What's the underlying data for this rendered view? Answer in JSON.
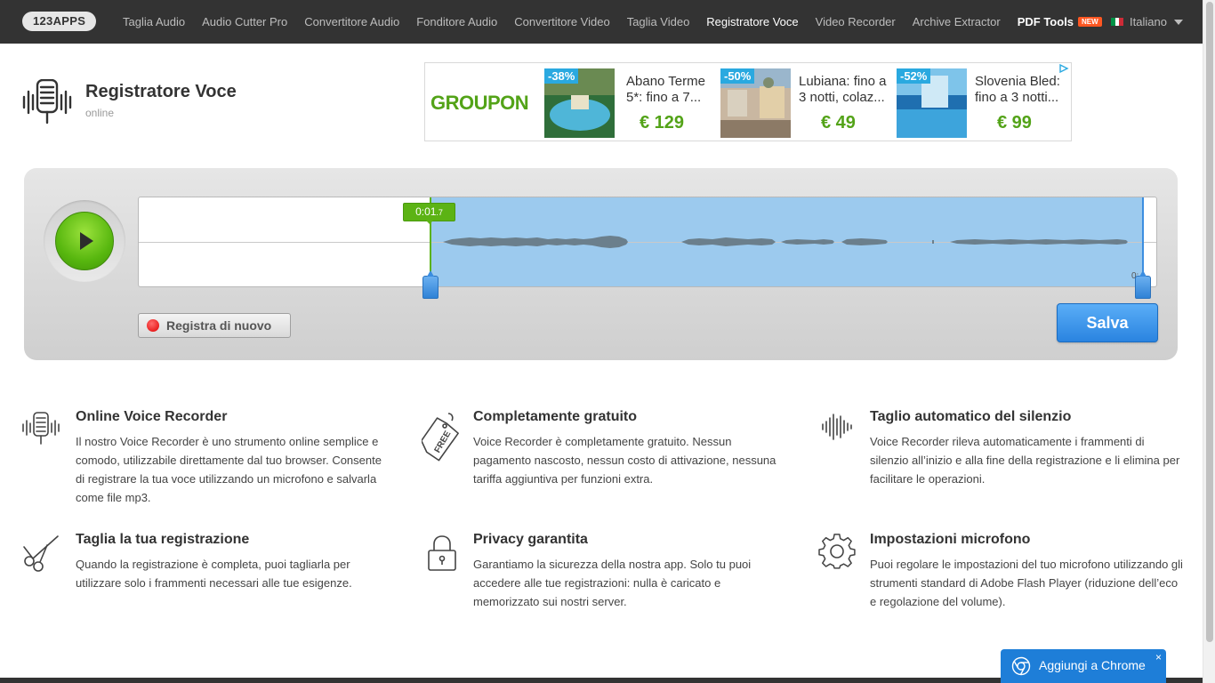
{
  "topbar": {
    "logo": "123APPS",
    "nav": [
      {
        "label": "Taglia Audio"
      },
      {
        "label": "Audio Cutter Pro"
      },
      {
        "label": "Convertitore Audio"
      },
      {
        "label": "Fonditore Audio"
      },
      {
        "label": "Convertitore Video"
      },
      {
        "label": "Taglia Video"
      },
      {
        "label": "Registratore Voce",
        "active": true
      },
      {
        "label": "Video Recorder"
      },
      {
        "label": "Archive Extractor"
      }
    ],
    "pdf_tools": "PDF Tools",
    "new_badge": "NEW",
    "language": "Italiano"
  },
  "app": {
    "title": "Registratore Voce",
    "subtitle": "online"
  },
  "ad": {
    "brand": "GROUPON",
    "deals": [
      {
        "discount": "-38%",
        "title": "Abano Terme 5*: fino a 7...",
        "price": "€ 129"
      },
      {
        "discount": "-50%",
        "title": "Lubiana: fino a 3 notti, colaz...",
        "price": "€ 49"
      },
      {
        "discount": "-52%",
        "title": "Slovenia Bled: fino a 3 notti...",
        "price": "€ 99"
      }
    ]
  },
  "player": {
    "current_time_main": "0:01",
    "current_time_frac": ".7",
    "end_time": "0:",
    "record_again": "Registra di nuovo",
    "save": "Salva"
  },
  "features": [
    {
      "icon": "microphone-icon",
      "title": "Online Voice Recorder",
      "text": "Il nostro Voice Recorder è uno strumento online semplice e comodo, utilizzabile direttamente dal tuo browser. Consente di registrare la tua voce utilizzando un microfono e salvarla come file mp3."
    },
    {
      "icon": "free-tag-icon",
      "title": "Completamente gratuito",
      "text": "Voice Recorder è completamente gratuito. Nessun pagamento nascosto, nessun costo di attivazione, nessuna tariffa aggiuntiva per funzioni extra."
    },
    {
      "icon": "waveform-icon",
      "title": "Taglio automatico del silenzio",
      "text": "Voice Recorder rileva automaticamente i frammenti di silenzio all’inizio e alla fine della registrazione e li elimina per facilitare le operazioni."
    },
    {
      "icon": "scissors-icon",
      "title": "Taglia la tua registrazione",
      "text": "Quando la registrazione è completa, puoi tagliarla per utilizzare solo i frammenti necessari alle tue esigenze."
    },
    {
      "icon": "lock-icon",
      "title": "Privacy garantita",
      "text": "Garantiamo la sicurezza della nostra app. Solo tu puoi accedere alle tue registrazioni: nulla è caricato e memorizzato sui nostri server."
    },
    {
      "icon": "gear-icon",
      "title": "Impostazioni microfono",
      "text": "Puoi regolare le impostazioni del tuo microfono utilizzando gli strumenti standard di Adobe Flash Player (riduzione dell’eco e regolazione del volume)."
    }
  ],
  "chrome_popup": {
    "label": "Aggiungi a Chrome",
    "close": "×"
  },
  "colors": {
    "topbar": "#333333",
    "accent_green": "#5cb314",
    "selection_blue": "#9ccaee",
    "save_blue": "#2a84e0",
    "groupon_green": "#53a318"
  }
}
